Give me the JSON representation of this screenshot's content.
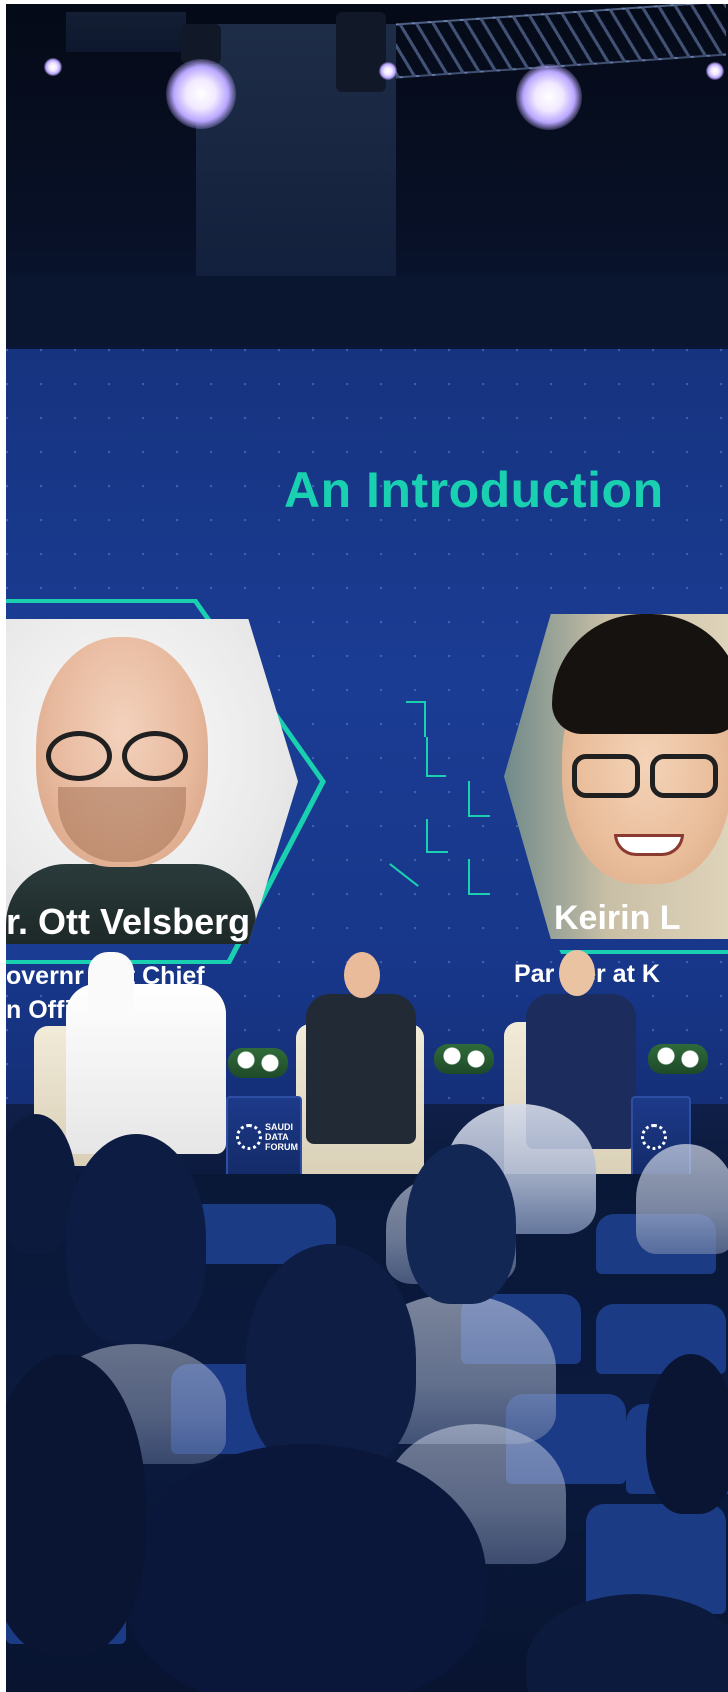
{
  "screen": {
    "title": "An Introduction",
    "speaker_left": {
      "name": "r. Ott Velsberg",
      "role_line1": "overnr    nt Chief",
      "role_line2": "n Offi      f Estonia"
    },
    "speaker_right": {
      "name": "Keirin L",
      "role_line1": "Par    er at K"
    }
  },
  "podium": {
    "line1": "SAUDI",
    "line2": "DATA",
    "line3": "FORUM"
  },
  "colors": {
    "accent": "#19d1b0",
    "screen_blue": "#1a3c93",
    "background": "#070d1d"
  }
}
